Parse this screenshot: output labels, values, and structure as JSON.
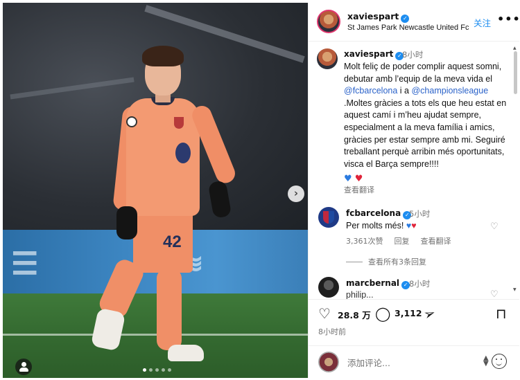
{
  "post": {
    "author": "xaviespart",
    "location": "St James Park Newcastle United Fc",
    "follow_label": "关注",
    "more_label": "•••",
    "next_arrow": "›",
    "caption": {
      "username": "xaviespart",
      "time": "8小时",
      "parts": {
        "p1": "Molt feliç de poder complir aquest somni, debutar amb l’equip de la meva vida el ",
        "m1": "@fcbarcelona",
        "p2": " i a ",
        "m2": "@championsleague",
        "p3": " .Moltes gràcies a tots els que heu estat en aquest camí i m’heu ajudat sempre, especialment a la meva família i amics, gràcies per estar sempre amb mi.  Seguiré treballant perquè arribin més oportunitats, visca el Barça sempre!!!!"
      },
      "emoji_blue": "♥",
      "emoji_red": "♥",
      "see_translation": "查看翻译"
    },
    "comments": [
      {
        "username": "fcbarcelona",
        "time": "5小时",
        "text": "Per molts més!",
        "emoji_blue": "♥",
        "emoji_red": "♥",
        "likes": "3,361次赞",
        "reply": "回复",
        "translate": "查看翻译",
        "view_replies": "查看所有3条回复"
      },
      {
        "username": "marcbernal",
        "time": "8小时",
        "text": "philip..."
      }
    ],
    "stats": {
      "likes": "28.8 万",
      "comments": "3,112",
      "posted": "8小时前"
    },
    "composer": {
      "placeholder": "添加评论..."
    },
    "carousel": {
      "slides": 5,
      "active": 1
    }
  },
  "colors": {
    "accent": "#1d8df0",
    "mention": "#2a62c9",
    "muted": "#737373",
    "kit": "#f39a72"
  },
  "icons": [
    "verified-icon",
    "heart-icon",
    "comment-icon",
    "share-icon",
    "bookmark-icon",
    "emoji-icon",
    "more-icon",
    "chevron-right-icon",
    "user-tag-icon"
  ]
}
